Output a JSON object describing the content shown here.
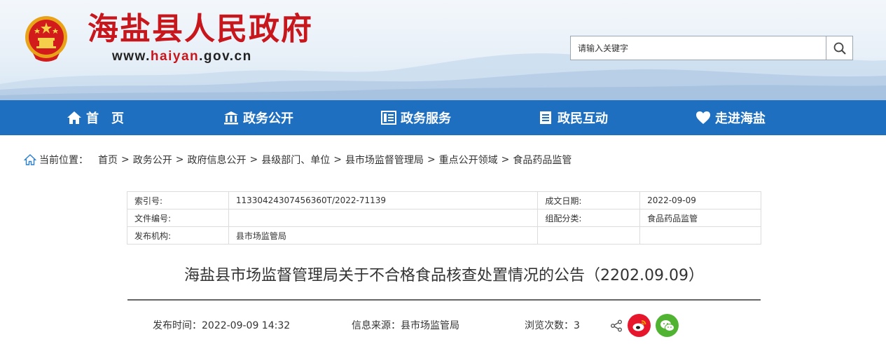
{
  "header": {
    "site_title": "海盐县人民政府",
    "url_prefix": "www.",
    "url_highlight": "haiyan",
    "url_suffix": ".gov.cn",
    "emblem_icon": "national-emblem-icon",
    "brand_red": "#c8161d"
  },
  "search": {
    "placeholder": "请输入关键字",
    "button_icon": "search-icon"
  },
  "nav": {
    "color": "#1e6fc0",
    "items": [
      {
        "label": "首　页",
        "icon": "home-icon"
      },
      {
        "label": "政务公开",
        "icon": "building-icon"
      },
      {
        "label": "政务服务",
        "icon": "service-list-icon"
      },
      {
        "label": "政民互动",
        "icon": "document-icon"
      },
      {
        "label": "走进海盐",
        "icon": "heart-icon"
      }
    ]
  },
  "breadcrumb": {
    "prefix": "当前位置：",
    "items": [
      "首页",
      "政务公开",
      "政府信息公开",
      "县级部门、单位",
      "县市场监督管理局",
      "重点公开领域",
      "食品药品监管"
    ],
    "separator": ">"
  },
  "meta": {
    "rows": [
      {
        "k1": "索引号:",
        "v1": "11330424307456360T/2022-71139",
        "k2": "成文日期:",
        "v2": "2022-09-09"
      },
      {
        "k1": "文件编号:",
        "v1": "",
        "k2": "组配分类:",
        "v2": "食品药品监管"
      },
      {
        "k1": "发布机构:",
        "v1": "县市场监管局",
        "k2": "",
        "v2": ""
      }
    ]
  },
  "article": {
    "title": "海盐县市场监督管理局关于不合格食品核查处置情况的公告（2202.09.09）",
    "publish_time": "发布时间：2022-09-09 14:32",
    "source": "信息来源：县市场监管局",
    "views": "浏览次数：3"
  },
  "share": {
    "share_icon": "share-icon",
    "weibo_icon": "weibo-icon",
    "wechat_icon": "wechat-icon",
    "weibo_color": "#e6162d",
    "wechat_color": "#50b432"
  }
}
